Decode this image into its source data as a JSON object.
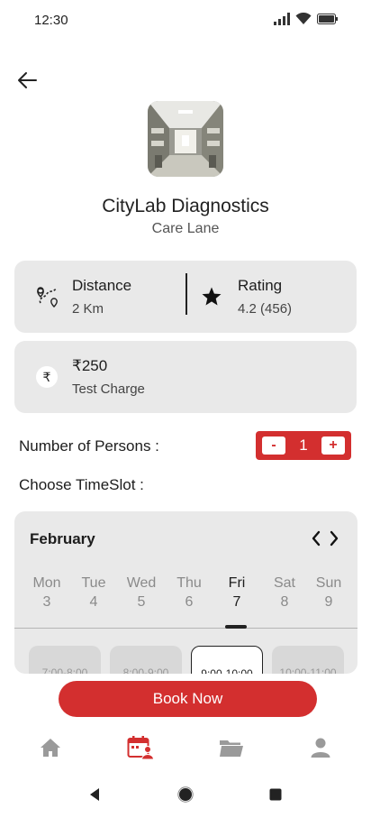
{
  "status_bar": {
    "time": "12:30",
    "icons": [
      "signal-icon",
      "wifi-icon",
      "battery-icon"
    ]
  },
  "lab": {
    "name": "CityLab Diagnostics",
    "location": "Care Lane"
  },
  "info": {
    "distance_label": "Distance",
    "distance_value": "2 Km",
    "rating_label": "Rating",
    "rating_value": "4.2 (456)"
  },
  "charge": {
    "amount": "₹250",
    "label": "Test Charge",
    "currency_symbol": "₹"
  },
  "persons": {
    "label": "Number of Persons :",
    "minus": "-",
    "count": "1",
    "plus": "+"
  },
  "timeslot": {
    "label": "Choose TimeSlot :"
  },
  "calendar": {
    "month": "February",
    "days": [
      {
        "name": "Mon",
        "num": "3"
      },
      {
        "name": "Tue",
        "num": "4"
      },
      {
        "name": "Wed",
        "num": "5"
      },
      {
        "name": "Thu",
        "num": "6"
      },
      {
        "name": "Fri",
        "num": "7"
      },
      {
        "name": "Sat",
        "num": "8"
      },
      {
        "name": "Sun",
        "num": "9"
      }
    ],
    "selected_day": "Fri",
    "slots": [
      "7:00-8:00",
      "8:00-9:00",
      "9:00-10:00",
      "10:00-11:00"
    ],
    "selected_slot": "9:00-10:00"
  },
  "actions": {
    "book_label": "Book Now"
  },
  "colors": {
    "accent": "#d32f2f",
    "card_bg": "#e9e9e9"
  },
  "bottom_nav": [
    "home-icon",
    "calendar-user-icon",
    "folder-icon",
    "person-icon"
  ],
  "system_nav": [
    "back-triangle-icon",
    "home-circle-icon",
    "recents-square-icon"
  ]
}
